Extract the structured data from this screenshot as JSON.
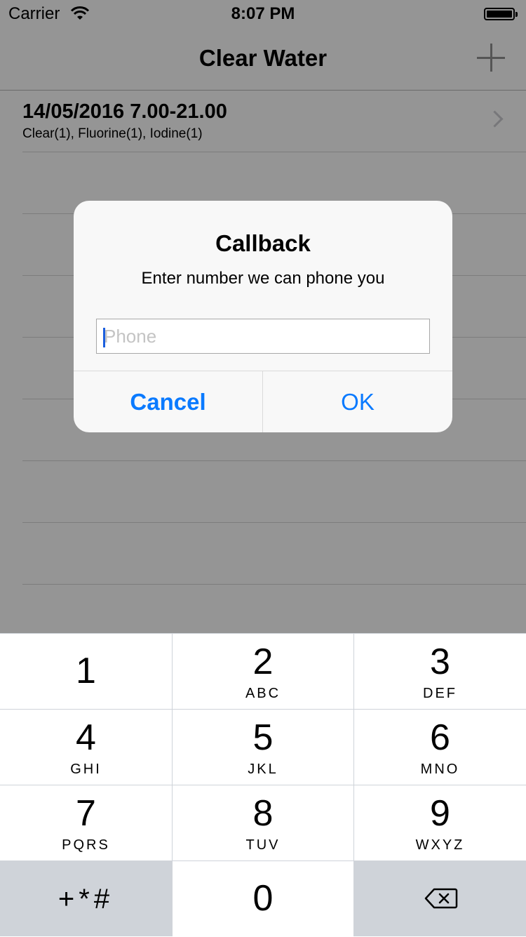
{
  "status_bar": {
    "carrier": "Carrier",
    "time": "8:07 PM"
  },
  "nav": {
    "title": "Clear Water",
    "add_icon": "plus-icon"
  },
  "list": {
    "items": [
      {
        "title": "14/05/2016 7.00-21.00",
        "subtitle": "Clear(1), Fluorine(1), Iodine(1)"
      }
    ]
  },
  "alert": {
    "title": "Callback",
    "message": "Enter number we can phone you",
    "input_placeholder": "Phone",
    "input_value": "",
    "cancel_label": "Cancel",
    "ok_label": "OK"
  },
  "keypad": {
    "keys": [
      {
        "digit": "1",
        "letters": ""
      },
      {
        "digit": "2",
        "letters": "ABC"
      },
      {
        "digit": "3",
        "letters": "DEF"
      },
      {
        "digit": "4",
        "letters": "GHI"
      },
      {
        "digit": "5",
        "letters": "JKL"
      },
      {
        "digit": "6",
        "letters": "MNO"
      },
      {
        "digit": "7",
        "letters": "PQRS"
      },
      {
        "digit": "8",
        "letters": "TUV"
      },
      {
        "digit": "9",
        "letters": "WXYZ"
      }
    ],
    "symbols_label": "+*#",
    "zero": "0",
    "delete_icon": "backspace-icon"
  },
  "colors": {
    "accent": "#0a7aff",
    "keypad_background": "#cfd3d9",
    "dim_overlay": "rgba(0,0,0,0.4)"
  }
}
